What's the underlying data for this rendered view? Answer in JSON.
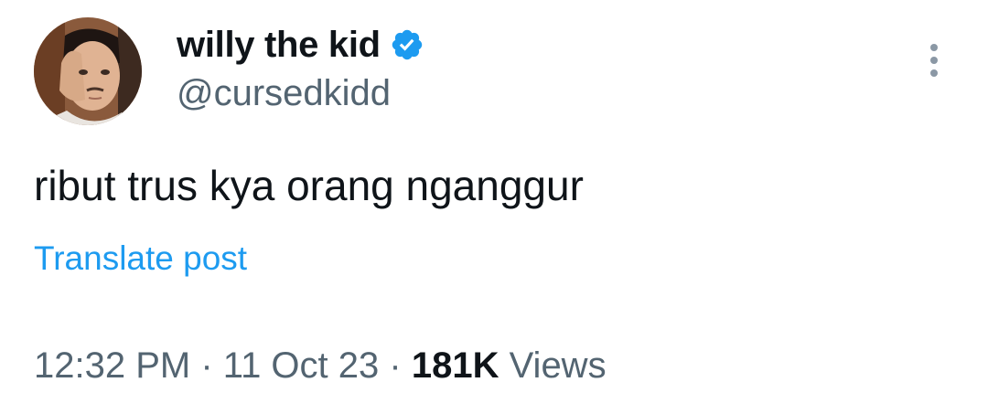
{
  "author": {
    "display_name": "willy the kid",
    "handle": "@cursedkidd",
    "verified": true,
    "avatar_icon": "profile-photo-avatar"
  },
  "menu": {
    "icon": "more-vertical-icon"
  },
  "post": {
    "text": "ribut trus kya orang nganggur",
    "translate_label": "Translate post"
  },
  "meta": {
    "time": "12:32 PM",
    "separator": "·",
    "date": "11 Oct 23",
    "views_count": "181K",
    "views_label": "Views"
  },
  "colors": {
    "text": "#0f1419",
    "secondary": "#536471",
    "link": "#1d9bf0",
    "verified_badge": "#1d9bf0"
  }
}
